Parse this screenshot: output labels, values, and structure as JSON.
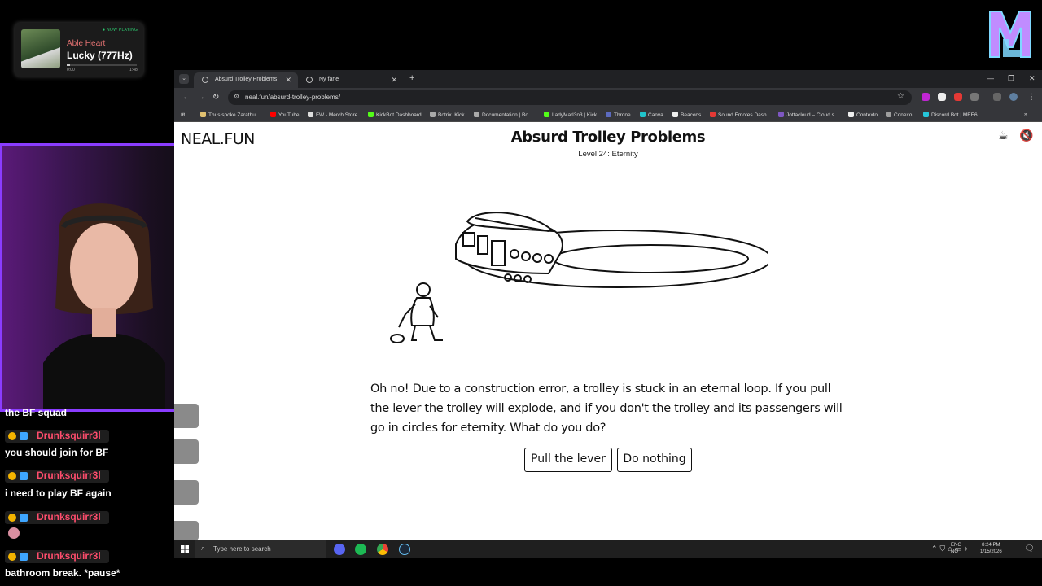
{
  "now_playing": {
    "badge": "● NOW PLAYING",
    "artist": "Able Heart",
    "title": "Lucky (777Hz)",
    "time_start": "0:00",
    "time_end": "1:48",
    "progress": 0.05
  },
  "chat": {
    "messages": [
      {
        "text": "the BF squad"
      },
      {
        "user": "Drunksquirr3l",
        "text": "you should join for BF"
      },
      {
        "user": "Drunksquirr3l",
        "text": "i need to play BF again"
      },
      {
        "user": "Drunksquirr3l",
        "text": ""
      },
      {
        "user": "Drunksquirr3l",
        "text": "bathroom break. *pause*"
      }
    ]
  },
  "browser": {
    "tabs": [
      {
        "label": "Absurd Trolley Problems"
      },
      {
        "label": "Ny fane"
      }
    ],
    "new_tab": "+",
    "tab_list": "⌄",
    "url": "neal.fun/absurd-trolley-problems/",
    "bookmarks": [
      "Thus spoke Zarathu...",
      "YouTube",
      "FW - Merch Store",
      "KickBot Dashboard",
      "Botrix. Kick",
      "Documentation | Bo...",
      "LadyMarl3n3 | Kick",
      "Throne",
      "Canva",
      "Beacons",
      "Sound Emotes Dash...",
      "Jottacloud – Cloud s...",
      "Contexto",
      "Conexo",
      "Discord Bot | MEE6"
    ]
  },
  "page": {
    "logo": "NEAL.FUN",
    "title": "Absurd Trolley Problems",
    "level": "Level 24: Eternity",
    "scenario": "Oh no! Due to a construction error, a trolley is stuck in an eternal loop. If you pull the lever the trolley will explode, and if you don't the trolley and its passengers will go in circles for eternity. What do you do?",
    "choices": {
      "pull": "Pull the lever",
      "nothing": "Do nothing"
    }
  },
  "taskbar": {
    "search_placeholder": "Type here to search",
    "lang_top": "ENG",
    "lang_bottom": "NO",
    "time": "8:24 PM",
    "date": "1/15/2026"
  }
}
